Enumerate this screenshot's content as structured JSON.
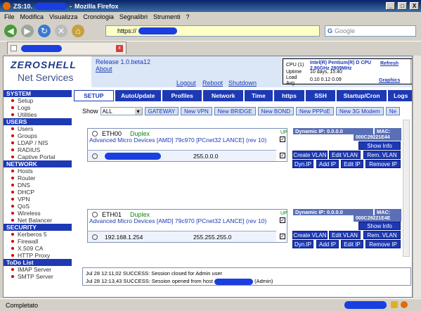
{
  "window": {
    "title": "ZS:10.",
    "app": "Mozilla Firefox",
    "buttons": [
      "_",
      "□",
      "X"
    ]
  },
  "menu": [
    "File",
    "Modifica",
    "Visualizza",
    "Cronologia",
    "Segnalibri",
    "Strumenti",
    "?"
  ],
  "url": {
    "prefix": "https://"
  },
  "search": {
    "placeholder": "Google"
  },
  "header": {
    "release": "Release 1.0.beta12",
    "about": "About",
    "logout": "Logout",
    "reboot": "Reboot",
    "shutdown": "Shutdown"
  },
  "logo": {
    "line1": "ZEROSHELL",
    "line2": "Net Services"
  },
  "cpu": {
    "cpu_label": "CPU (1)",
    "cpu_value": "Intel(R) Pentium(R) D CPU 2.80GHz 2809MHz",
    "uptime_label": "Uptime",
    "uptime_value": "10 days, 15:40",
    "load_label": "Load Avg",
    "load_value": "0.10 0.12 0.09",
    "refresh": "Refresh",
    "graphics": "Graphics"
  },
  "tabs": [
    "SETUP",
    "AutoUpdate",
    "Profiles",
    "Network",
    "Time",
    "https",
    "SSH",
    "Startup/Cron",
    "Logs"
  ],
  "sidebar": [
    {
      "section": "SYSTEM",
      "items": [
        "Setup",
        "Logs",
        "Utilities"
      ]
    },
    {
      "section": "USERS",
      "items": [
        "Users",
        "Groups",
        "LDAP / NIS",
        "RADIUS",
        "Captive Portal"
      ]
    },
    {
      "section": "NETWORK",
      "items": [
        "Hosts",
        "Router",
        "DNS",
        "DHCP",
        "VPN",
        "QoS",
        "Wireless",
        "Net Balancer"
      ]
    },
    {
      "section": "SECURITY",
      "items": [
        "Kerberos 5",
        "Firewall",
        "X.509 CA",
        "HTTP Proxy"
      ]
    },
    {
      "section": "ToDo List",
      "items": [
        "IMAP Server",
        "SMTP Server"
      ]
    }
  ],
  "toolbar": {
    "show_label": "Show",
    "show_value": "ALL",
    "buttons": [
      "GATEWAY",
      "New VPN",
      "New BRIDGE",
      "New BOND",
      "New PPPoE",
      "New 3G Modem",
      "Ne"
    ]
  },
  "eth0": {
    "name": "ETH00",
    "duplex": "Duplex",
    "desc": "Advanced Micro Devices [AMD] 79c970 [PCnet32 LANCE] (rev 10)",
    "up": "UP",
    "mask": "255.0.0.0",
    "dyn": "Dynamic IP: 0.0.0.0",
    "mac": "MAC:",
    "mac_val": "000C29221E44"
  },
  "eth1": {
    "name": "ETH01",
    "duplex": "Duplex",
    "desc": "Advanced Micro Devices [AMD] 79c970 [PCnet32 LANCE] (rev 10)",
    "up": "UP",
    "ip": "192.168.1.254",
    "mask": "255.255.255.0",
    "dyn": "Dynamic IP: 0.0.0.0",
    "mac": "MAC:",
    "mac_val": "000C29221E4E"
  },
  "eth_buttons": {
    "show_info": "Show Info",
    "create_vlan": "Create VLAN",
    "edit_vlan": "Edit VLAN",
    "rem_vlan": "Rem. VLAN",
    "dyn_ip": "Dyn.IP",
    "add_ip": "Add IP",
    "edit_ip": "Edit IP",
    "remove_ip": "Remove IP"
  },
  "log": [
    "Jul 28 12:11,02 SUCCESS: Session closed for Admin user",
    "Jul 28 12:13,43 SUCCESS: Session opened from host",
    "(Admin)"
  ],
  "status": "Completato",
  "colors": {
    "accent": "#1d39b4",
    "section_bg": "#1d39b4",
    "header_bg": "#dbe6f7"
  }
}
